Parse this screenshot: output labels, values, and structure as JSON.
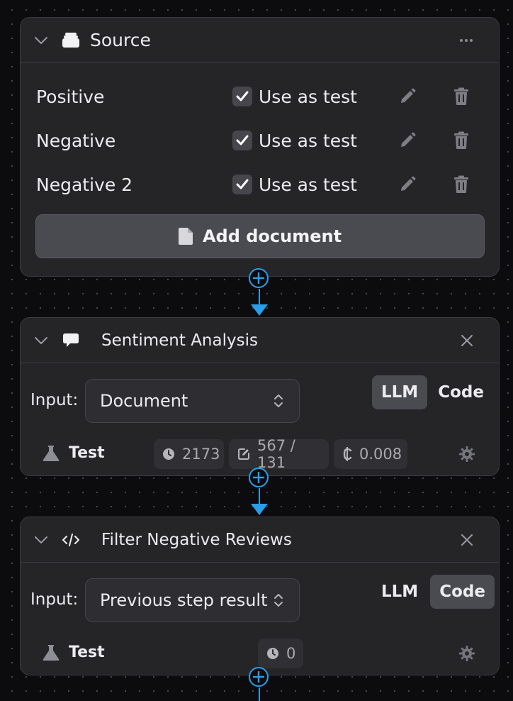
{
  "source": {
    "title": "Source",
    "documents": [
      {
        "name": "Positive",
        "check_label": "Use as test"
      },
      {
        "name": "Negative",
        "check_label": "Use as test"
      },
      {
        "name": "Negative 2",
        "check_label": "Use as test"
      }
    ],
    "add_label": "Add document"
  },
  "steps": [
    {
      "title": "Sentiment Analysis",
      "input_label": "Input:",
      "input_value": "Document",
      "toggle": {
        "llm": "LLM",
        "code": "Code",
        "active": "llm"
      },
      "test_label": "Test",
      "stats": {
        "time": "2173",
        "tokens": "567 / 131",
        "cost": "0.008"
      }
    },
    {
      "title": "Filter Negative Reviews",
      "input_label": "Input:",
      "input_value": "Previous step result",
      "toggle": {
        "llm": "LLM",
        "code": "Code",
        "active": "code"
      },
      "test_label": "Test",
      "stats": {
        "time": "0"
      }
    }
  ],
  "colors": {
    "accent": "#2a9ee8",
    "card": "#252528",
    "background": "#0c0c0e"
  }
}
